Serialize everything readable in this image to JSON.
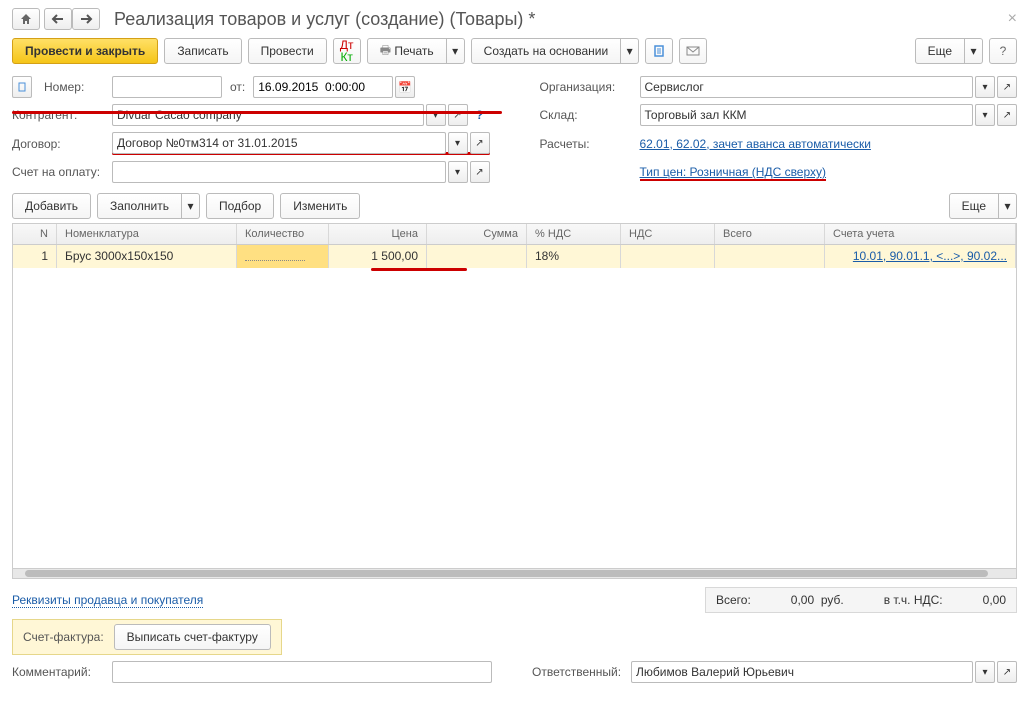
{
  "title": "Реализация товаров и услуг (создание) (Товары) *",
  "toolbar": {
    "post_close": "Провести и закрыть",
    "write": "Записать",
    "post": "Провести",
    "print": "Печать",
    "create_based": "Создать на основании",
    "more": "Еще"
  },
  "form": {
    "number_label": "Номер:",
    "number_value": "",
    "ot_label": "от:",
    "date_value": "16.09.2015  0:00:00",
    "org_label": "Организация:",
    "org_value": "Сервислог",
    "counterparty_label": "Контрагент:",
    "counterparty_value": "Divuar Cacao company",
    "warehouse_label": "Склад:",
    "warehouse_value": "Торговый зал ККМ",
    "contract_label": "Договор:",
    "contract_value": "Договор №0тм314 от 31.01.2015",
    "calc_label": "Расчеты:",
    "calc_link": "62.01, 62.02, зачет аванса автоматически",
    "invoice_label": "Счет на оплату:",
    "invoice_value": "",
    "price_type_link": "Тип цен: Розничная (НДС сверху)"
  },
  "table_toolbar": {
    "add": "Добавить",
    "fill": "Заполнить",
    "select": "Подбор",
    "change": "Изменить",
    "more": "Еще"
  },
  "columns": {
    "n": "N",
    "nom": "Номенклатура",
    "qty": "Количество",
    "price": "Цена",
    "sum": "Сумма",
    "vat_pct": "% НДС",
    "nds": "НДС",
    "total": "Всего",
    "acct": "Счета учета"
  },
  "rows": [
    {
      "n": "1",
      "nom": "Брус 3000х150х150",
      "qty": "",
      "price": "1 500,00",
      "sum": "",
      "vat_pct": "18%",
      "nds": "",
      "total": "",
      "acct": "10.01, 90.01.1, <...>, 90.02..."
    }
  ],
  "footer": {
    "seller_buyer_link": "Реквизиты продавца и покупателя",
    "totals_label": "Всего:",
    "totals_value": "0,00",
    "totals_cur": "руб.",
    "vat_label": "в т.ч. НДС:",
    "vat_value": "0,00",
    "sf_label": "Счет-фактура:",
    "sf_button": "Выписать счет-фактуру",
    "comment_label": "Комментарий:",
    "comment_value": "",
    "responsible_label": "Ответственный:",
    "responsible_value": "Любимов Валерий Юрьевич"
  }
}
